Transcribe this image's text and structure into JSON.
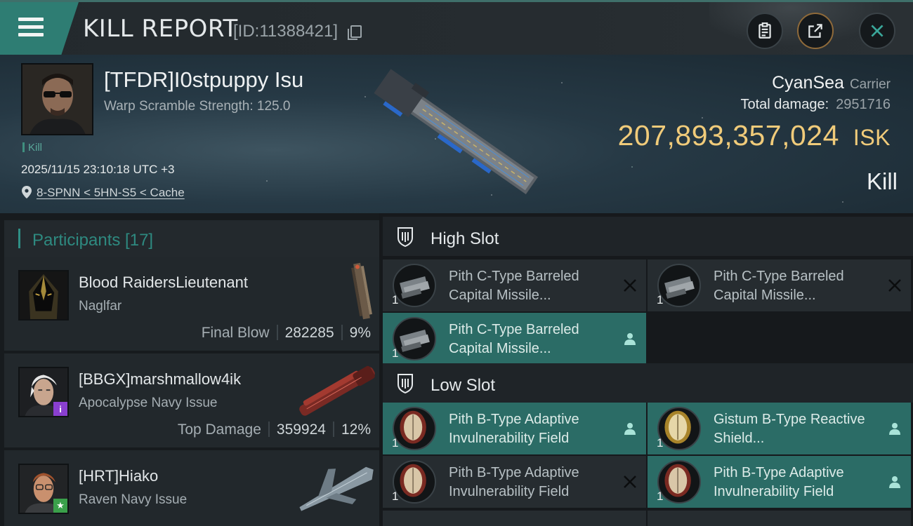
{
  "header": {
    "title": "KILL REPORT",
    "report_id": "[ID:11388421]"
  },
  "victim": {
    "name": "[TFDR]I0stpuppy Isu",
    "warp_scramble": "Warp Scramble Strength: 125.0",
    "tag": "Kill",
    "timestamp": "2025/11/15 23:10:18 UTC +3",
    "location": "8-SPNN < 5HN-S5 < Cache",
    "ship": "CyanSea",
    "ship_class": "Carrier",
    "total_damage_label": "Total damage:",
    "total_damage": "2951716",
    "isk_value": "207,893,357,024",
    "isk_currency": "ISK",
    "result": "Kill"
  },
  "participants": {
    "title": "Participants [17]",
    "rows": [
      {
        "name": "Blood RaidersLieutenant",
        "ship": "Naglfar",
        "role": "Final Blow",
        "damage": "282285",
        "percent": "9%"
      },
      {
        "name": "[BBGX]marshmallow4ik",
        "ship": "Apocalypse Navy Issue",
        "role": "Top Damage",
        "damage": "359924",
        "percent": "12%",
        "badge": "i"
      },
      {
        "name": "[HRT]Hiako",
        "ship": "Raven Navy Issue",
        "badge": "★"
      }
    ]
  },
  "slots": {
    "high": {
      "title": "High Slot",
      "modules": [
        {
          "qty": "1",
          "name": "Pith C-Type Barreled Capital Missile...",
          "state": "destroyed"
        },
        {
          "qty": "1",
          "name": "Pith C-Type Barreled Capital Missile...",
          "state": "destroyed"
        },
        {
          "qty": "1",
          "name": "Pith C-Type Barreled Capital Missile...",
          "state": "dropped"
        }
      ]
    },
    "low": {
      "title": "Low Slot",
      "modules": [
        {
          "qty": "1",
          "name": "Pith B-Type Adaptive Invulnerability Field",
          "state": "dropped"
        },
        {
          "qty": "1",
          "name": "Gistum B-Type Reactive Shield...",
          "state": "dropped"
        },
        {
          "qty": "1",
          "name": "Pith B-Type Adaptive Invulnerability Field",
          "state": "destroyed"
        },
        {
          "qty": "1",
          "name": "Pith B-Type Adaptive Invulnerability Field",
          "state": "dropped"
        }
      ]
    }
  },
  "icons": {
    "menu": "hamburger-icon",
    "clipboard": "clipboard-icon",
    "share": "share-icon",
    "close": "close-icon",
    "location": "location-pin-icon",
    "destroyed": "x-mark-icon",
    "dropped": "person-icon",
    "slot": "slot-shield-icon"
  },
  "colors": {
    "accent": "#2e7d73",
    "isk": "#f0cb7a",
    "active_module": "#2b6c66"
  }
}
